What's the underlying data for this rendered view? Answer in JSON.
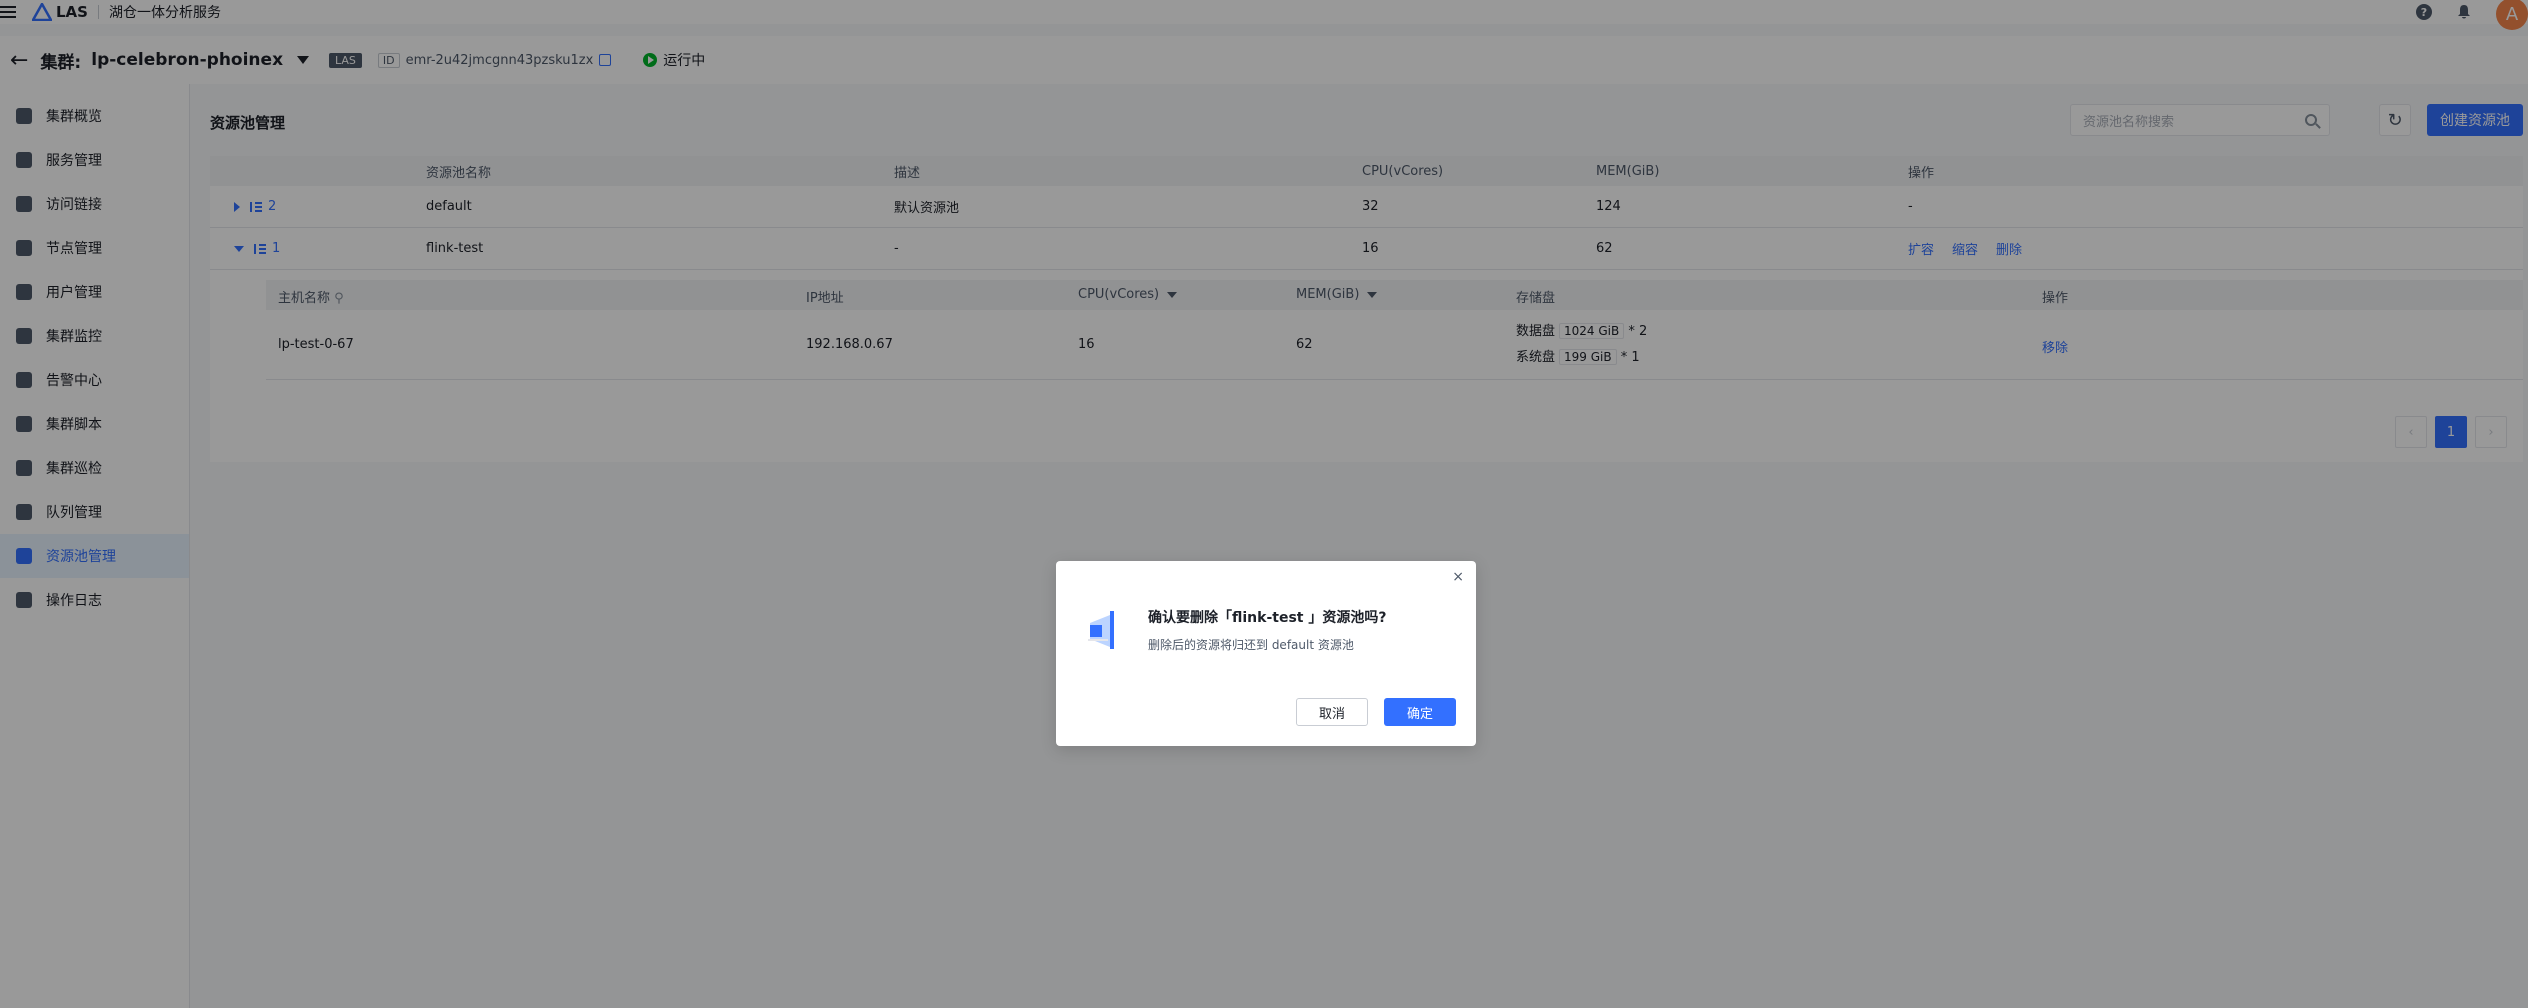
{
  "topbar": {
    "logo_text": "LAS",
    "service_name": "湖仓一体分析服务",
    "avatar_letter": "A",
    "help_glyph": "?"
  },
  "cluster": {
    "label": "集群:",
    "name": "lp-celebron-phoinex",
    "tag": "LAS",
    "id_label": "ID",
    "id_value": "emr-2u42jmcgnn43pzsku1zx",
    "status": "运行中"
  },
  "sidebar": {
    "items": [
      {
        "label": "集群概览",
        "icon": "overview-icon"
      },
      {
        "label": "服务管理",
        "icon": "service-icon"
      },
      {
        "label": "访问链接",
        "icon": "link-icon"
      },
      {
        "label": "节点管理",
        "icon": "node-icon"
      },
      {
        "label": "用户管理",
        "icon": "user-icon"
      },
      {
        "label": "集群监控",
        "icon": "monitor-icon"
      },
      {
        "label": "告警中心",
        "icon": "alarm-icon"
      },
      {
        "label": "集群脚本",
        "icon": "script-icon"
      },
      {
        "label": "集群巡检",
        "icon": "inspect-icon"
      },
      {
        "label": "队列管理",
        "icon": "queue-icon"
      },
      {
        "label": "资源池管理",
        "icon": "pool-icon"
      },
      {
        "label": "操作日志",
        "icon": "log-icon"
      }
    ],
    "active_index": 10
  },
  "main": {
    "title": "资源池管理",
    "search_placeholder": "资源池名称搜索",
    "create_label": "创建资源池",
    "columns": [
      "资源池名称",
      "描述",
      "CPU(vCores)",
      "MEM(GiB)",
      "操作"
    ],
    "rows": [
      {
        "count": "2",
        "name": "default",
        "desc": "默认资源池",
        "cpu": "32",
        "mem": "124",
        "ops": "-"
      },
      {
        "count": "1",
        "name": "flink-test",
        "desc": "-",
        "cpu": "16",
        "mem": "62",
        "op1": "扩容",
        "op2": "缩容",
        "op3": "删除"
      }
    ],
    "sub_columns": [
      "主机名称",
      "IP地址",
      "CPU(vCores)",
      "MEM(GiB)",
      "存储盘",
      "操作"
    ],
    "sub_row": {
      "host": "lp-test-0-67",
      "ip": "192.168.0.67",
      "cpu": "16",
      "mem": "62",
      "disk1_label": "数据盘",
      "disk1_size": "1024 GiB",
      "disk1_count": "* 2",
      "disk2_label": "系统盘",
      "disk2_size": "199 GiB",
      "disk2_count": "* 1",
      "op": "移除"
    },
    "pager": {
      "prev": "‹",
      "page": "1",
      "next": "›"
    }
  },
  "modal": {
    "title": "确认要删除「flink-test 」资源池吗?",
    "desc": "删除后的资源将归还到 default 资源池",
    "cancel": "取消",
    "ok": "确定",
    "close": "×"
  },
  "colors": {
    "accent": "#3370ff",
    "status": "#00b42a"
  }
}
